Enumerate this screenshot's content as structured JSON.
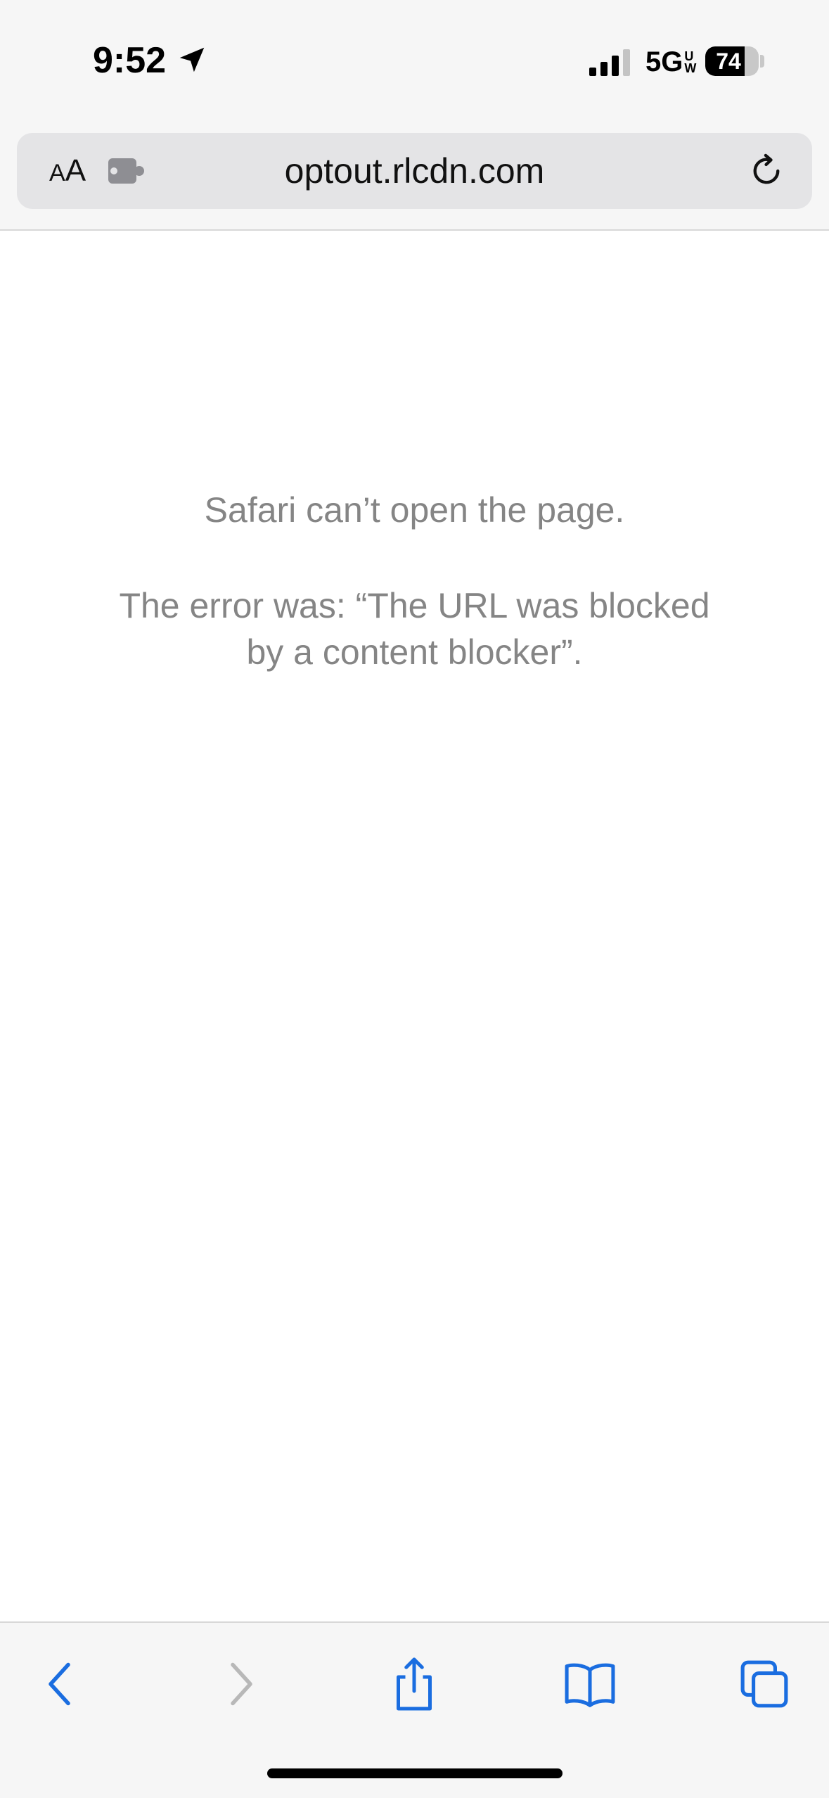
{
  "status_bar": {
    "time": "9:52",
    "network": "5G",
    "network_sub_top": "U",
    "network_sub_bottom": "W",
    "battery_level": "74",
    "battery_fraction": 0.74
  },
  "url_bar": {
    "reader_label_small": "A",
    "reader_label_large": "A",
    "url": "optout.rlcdn.com",
    "icons": [
      "extension-icon",
      "reload-icon"
    ]
  },
  "error": {
    "title": "Safari can’t open the page.",
    "detail": "The error was: “The URL was blocked by a content blocker”."
  },
  "toolbar": {
    "icons": [
      "back-icon",
      "forward-icon",
      "share-icon",
      "bookmarks-icon",
      "tabs-icon"
    ],
    "accent_color": "#1a6de0",
    "disabled_color": "#b8b8b8"
  },
  "colors": {
    "chrome_bg": "#f6f6f6",
    "url_field_bg": "#e4e4e6",
    "error_text": "#858585"
  }
}
